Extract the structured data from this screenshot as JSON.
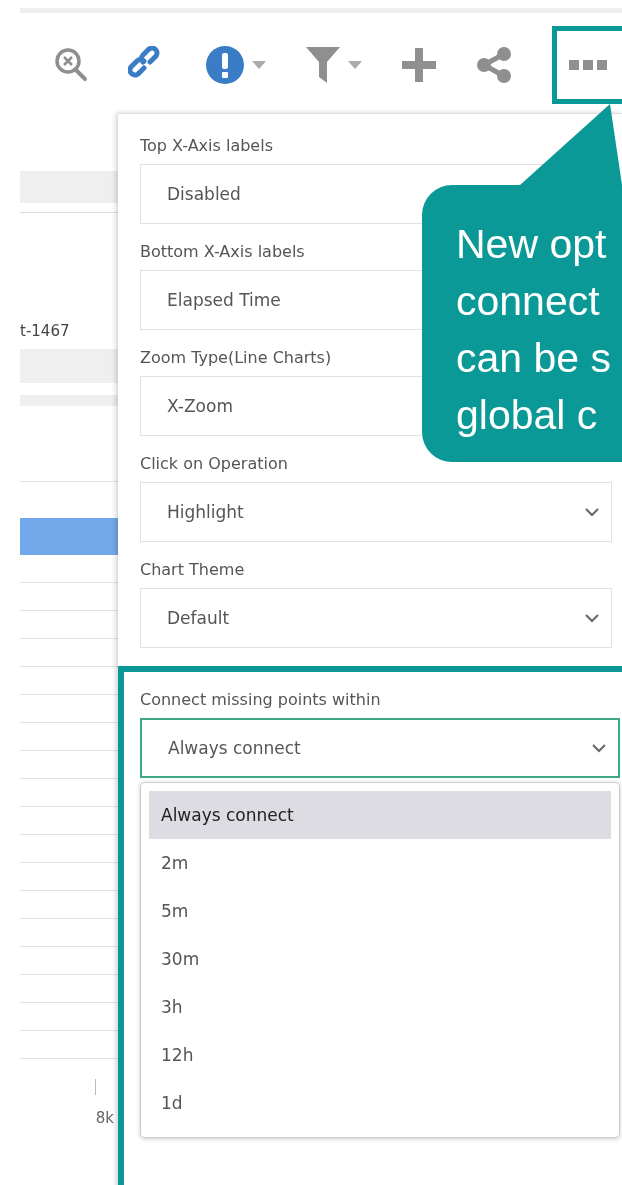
{
  "toolbar": [
    {
      "kind": "zoom-reset",
      "menu": false,
      "highlighted": false
    },
    {
      "kind": "link",
      "menu": false,
      "highlighted": false
    },
    {
      "kind": "alert",
      "menu": true,
      "highlighted": false
    },
    {
      "kind": "filter",
      "menu": true,
      "highlighted": false
    },
    {
      "kind": "add",
      "menu": false,
      "highlighted": false
    },
    {
      "kind": "share",
      "menu": false,
      "highlighted": false
    },
    {
      "kind": "more",
      "menu": false,
      "highlighted": true
    }
  ],
  "background_chart": {
    "row_label": "t-1467",
    "tick_label": "8k"
  },
  "settings": [
    {
      "label": "Top X-Axis labels",
      "value": "Disabled",
      "highlighted": false,
      "open": false
    },
    {
      "label": "Bottom X-Axis labels",
      "value": "Elapsed Time",
      "highlighted": false,
      "open": false
    },
    {
      "label": "Zoom Type(Line Charts)",
      "value": "X-Zoom",
      "highlighted": false,
      "open": false
    },
    {
      "label": "Click on Operation",
      "value": "Highlight",
      "arrow": true,
      "highlighted": false,
      "open": false
    },
    {
      "label": "Chart Theme",
      "value": "Default",
      "arrow": true,
      "highlighted": false,
      "open": false
    },
    {
      "label": "Connect missing points within",
      "value": "Always connect",
      "arrow": true,
      "highlighted": true,
      "open": true,
      "options": [
        {
          "label": "Always connect",
          "selected": true
        },
        {
          "label": "2m",
          "selected": false
        },
        {
          "label": "5m",
          "selected": false
        },
        {
          "label": "30m",
          "selected": false
        },
        {
          "label": "3h",
          "selected": false
        },
        {
          "label": "12h",
          "selected": false
        },
        {
          "label": "1d",
          "selected": false
        }
      ]
    }
  ],
  "callout": {
    "lines": [
      "New opt",
      "connect",
      "can be s",
      "global c"
    ]
  }
}
